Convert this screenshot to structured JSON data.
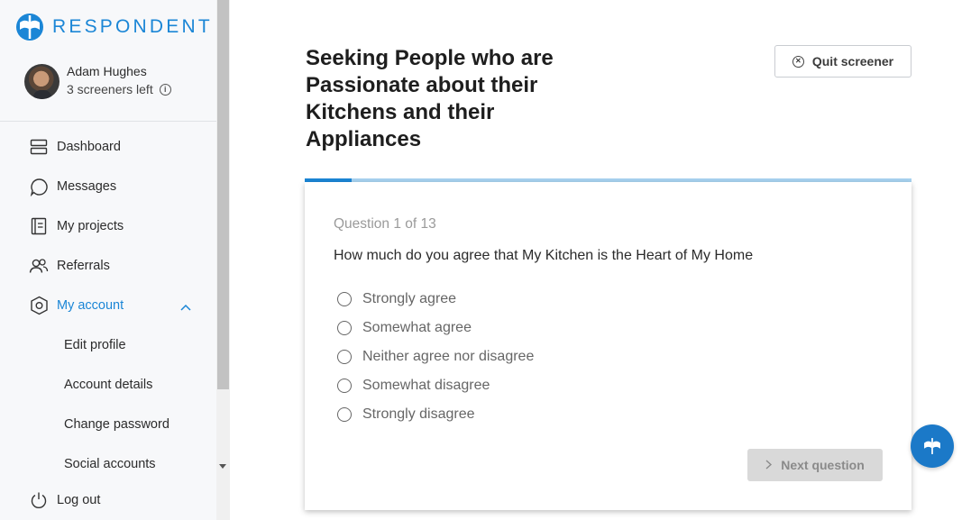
{
  "brand": {
    "name": "RESPONDENT",
    "accent": "#1b86d6"
  },
  "user": {
    "name": "Adam Hughes",
    "screeners_left": "3 screeners left"
  },
  "nav": {
    "items": [
      {
        "label": "Dashboard",
        "icon": "dashboard-icon"
      },
      {
        "label": "Messages",
        "icon": "message-icon"
      },
      {
        "label": "My projects",
        "icon": "projects-icon"
      },
      {
        "label": "Referrals",
        "icon": "referrals-icon"
      },
      {
        "label": "My account",
        "icon": "account-icon",
        "active": true,
        "expanded": true
      }
    ],
    "sub_items": [
      {
        "label": "Edit profile"
      },
      {
        "label": "Account details"
      },
      {
        "label": "Change password"
      },
      {
        "label": "Social accounts"
      }
    ],
    "logout_label": "Log out"
  },
  "screener": {
    "title": "Seeking People who are Passionate about their Kitchens and their Appliances",
    "quit_label": "Quit screener",
    "progress": 0.077,
    "question_number": "Question 1 of 13",
    "question_text": "How much do you agree that My Kitchen is the Heart of My Home",
    "options": [
      "Strongly agree",
      "Somewhat agree",
      "Neither agree nor disagree",
      "Somewhat disagree",
      "Strongly disagree"
    ],
    "next_label": "Next question"
  }
}
